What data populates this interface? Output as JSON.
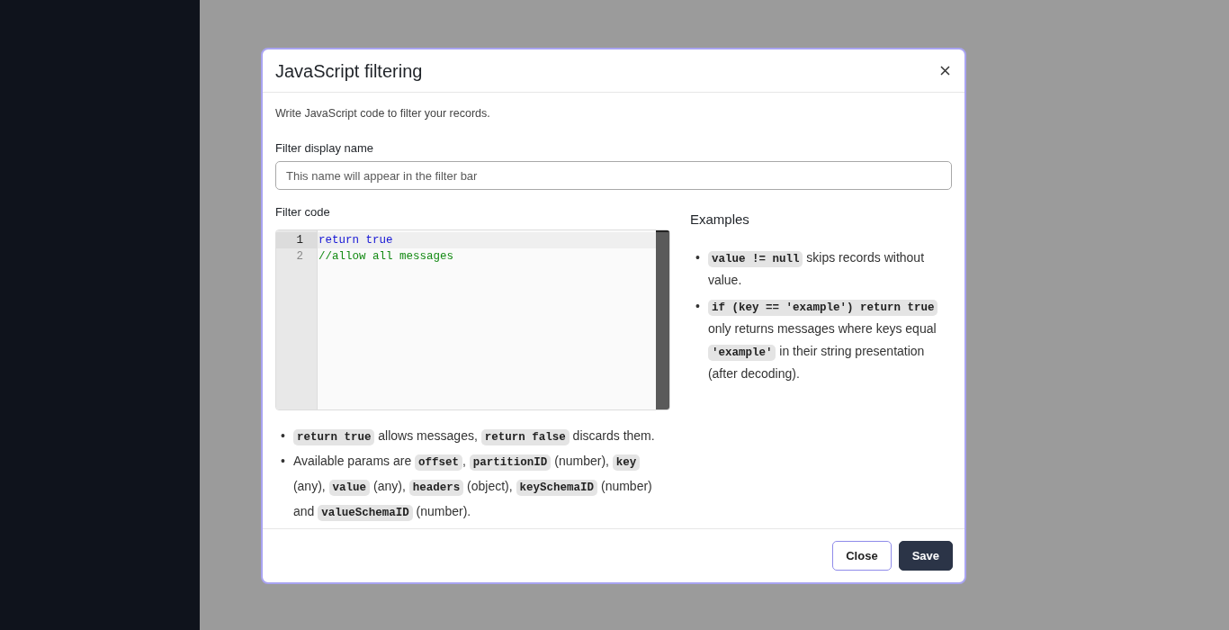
{
  "dialog": {
    "title": "JavaScript filtering",
    "description": "Write JavaScript code to filter your records.",
    "name_field": {
      "label": "Filter display name",
      "placeholder": "This name will appear in the filter bar"
    },
    "code_field": {
      "label": "Filter code",
      "lines": [
        {
          "number": "1",
          "text": "return true",
          "kind": "keyword",
          "selected": true
        },
        {
          "number": "2",
          "text": "//allow all messages",
          "kind": "comment",
          "selected": false
        }
      ]
    },
    "notes": [
      {
        "marker": "•",
        "parts": [
          {
            "kind": "code",
            "text": "return true"
          },
          {
            "kind": "text",
            "text": " allows messages, "
          },
          {
            "kind": "code",
            "text": "return false"
          },
          {
            "kind": "text",
            "text": " discards them."
          }
        ]
      },
      {
        "marker": "•",
        "parts": [
          {
            "kind": "text",
            "text": "Available params are "
          },
          {
            "kind": "code",
            "text": "offset"
          },
          {
            "kind": "text",
            "text": ", "
          },
          {
            "kind": "code",
            "text": "partitionID"
          },
          {
            "kind": "text",
            "text": " (number), "
          },
          {
            "kind": "code",
            "text": "key"
          },
          {
            "kind": "text",
            "text": " (any), "
          },
          {
            "kind": "code",
            "text": "value"
          },
          {
            "kind": "text",
            "text": " (any), "
          },
          {
            "kind": "code",
            "text": "headers"
          },
          {
            "kind": "text",
            "text": " (object), "
          },
          {
            "kind": "code",
            "text": "keySchemaID"
          },
          {
            "kind": "text",
            "text": " (number) and "
          },
          {
            "kind": "code",
            "text": "valueSchemaID"
          },
          {
            "kind": "text",
            "text": " (number)."
          }
        ]
      }
    ],
    "examples_title": "Examples",
    "examples": [
      {
        "marker": "•",
        "parts": [
          {
            "kind": "code",
            "text": "value != null"
          },
          {
            "kind": "text",
            "text": " skips records without value."
          }
        ]
      },
      {
        "marker": "•",
        "parts": [
          {
            "kind": "code",
            "text": "if (key == 'example') return true"
          },
          {
            "kind": "text",
            "text": " only returns messages where keys equal "
          },
          {
            "kind": "code",
            "text": "'example'"
          },
          {
            "kind": "text",
            "text": " in their string presentation (after decoding)."
          }
        ]
      }
    ],
    "buttons": [
      {
        "label": "Close",
        "kind": "secondary"
      },
      {
        "label": "Save",
        "kind": "primary"
      }
    ]
  }
}
